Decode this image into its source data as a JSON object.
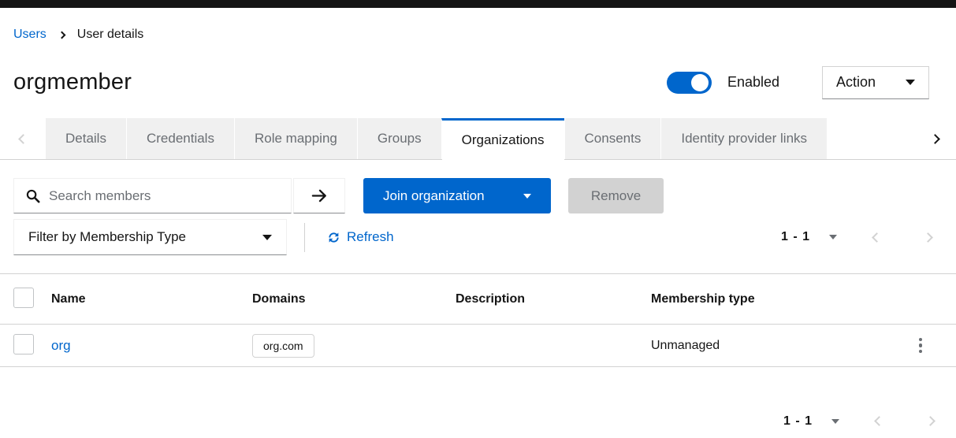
{
  "breadcrumb": {
    "items": [
      {
        "label": "Users"
      },
      {
        "label": "User details"
      }
    ]
  },
  "header": {
    "title": "orgmember",
    "toggle_label": "Enabled",
    "toggle_enabled": true,
    "action_button": "Action"
  },
  "tabs": {
    "active": "Organizations",
    "items": [
      {
        "label": "Details",
        "active": false
      },
      {
        "label": "Credentials",
        "active": false
      },
      {
        "label": "Role mapping",
        "active": false
      },
      {
        "label": "Groups",
        "active": false
      },
      {
        "label": "Organizations",
        "active": true
      },
      {
        "label": "Consents",
        "active": false
      },
      {
        "label": "Identity provider links",
        "active": false
      }
    ]
  },
  "toolbar": {
    "search": {
      "placeholder": "Search members",
      "value": ""
    },
    "join_button": "Join organization",
    "remove_button": "Remove",
    "remove_disabled": true
  },
  "filter_bar": {
    "filter_dropdown": "Filter by Membership Type",
    "refresh": "Refresh"
  },
  "pagination": {
    "top": {
      "range": "1 - 1",
      "prev_enabled": false,
      "next_enabled": false
    },
    "bottom": {
      "range": "1 - 1",
      "prev_enabled": false,
      "next_enabled": false
    }
  },
  "table": {
    "columns": [
      "Name",
      "Domains",
      "Description",
      "Membership type"
    ],
    "select_all_checked": false,
    "rows": [
      {
        "selected": false,
        "name": "org",
        "domain": "org.com",
        "description": "",
        "membership_type": "Unmanaged"
      }
    ]
  },
  "icons": {
    "search": "magnifier",
    "search_submit": "arrow-right",
    "refresh": "sync-circular-arrows",
    "kebab": "vertical-dots",
    "dropdown_caret": "triangle-down",
    "breadcrumb_separator": "chevron-right",
    "tab_scroll": "chevron-left-right",
    "pagination_nav": "chevron-left-right"
  },
  "colors": {
    "accent": "#0066cc",
    "masthead_bg": "#151515",
    "text": "#151515",
    "text_muted": "#6a6e73",
    "tab_inactive_bg": "#f0f0f0",
    "border": "#d2d2d2",
    "border_dark": "#8a8d90",
    "disabled_bg": "#d2d2d2",
    "link": "#0066cc"
  }
}
